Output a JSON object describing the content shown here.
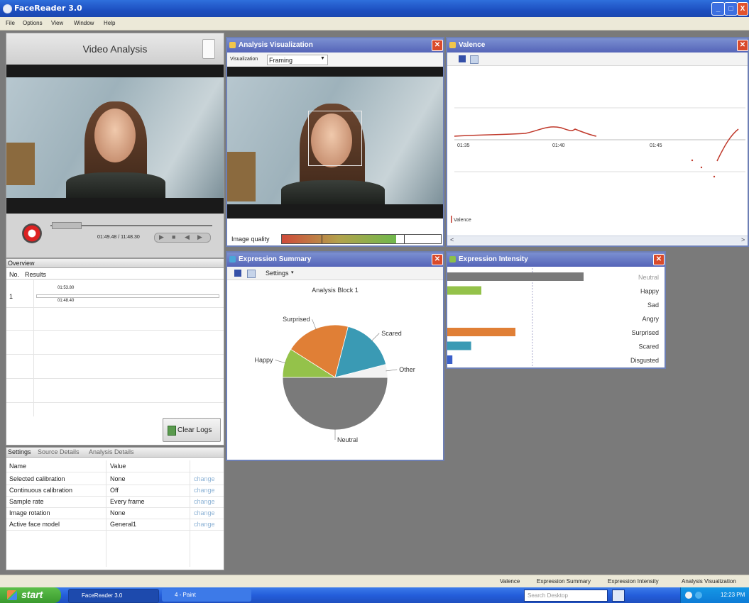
{
  "app": {
    "title": "FaceReader 3.0"
  },
  "window_buttons": {
    "minimize": "_",
    "maximize": "□",
    "close": "X"
  },
  "menu": [
    "File",
    "Options",
    "View",
    "Window",
    "Help"
  ],
  "video_panel": {
    "title": "Video Analysis",
    "time": "01:49.48 / 11:48.30"
  },
  "overview": {
    "title": "Overview",
    "columns": [
      "No.",
      "Results"
    ],
    "rows": [
      {
        "no": "1",
        "time_start": "01:53.80",
        "time_end": "01:48.40"
      }
    ],
    "clear_logs": "Clear Logs"
  },
  "settings": {
    "tabs": [
      "Settings",
      "Source Details",
      "Analysis Details"
    ],
    "columns": [
      "Name",
      "Value"
    ],
    "rows": [
      {
        "name": "Selected calibration",
        "value": "None",
        "action": "change"
      },
      {
        "name": "Continuous calibration",
        "value": "Off",
        "action": "change"
      },
      {
        "name": "Sample rate",
        "value": "Every frame",
        "action": "change"
      },
      {
        "name": "Image rotation",
        "value": "None",
        "action": "change"
      },
      {
        "name": "Active face model",
        "value": "General1",
        "action": "change"
      }
    ]
  },
  "analysis_vis": {
    "title": "Analysis Visualization",
    "vis_label": "Visualization",
    "vis_value": "Framing",
    "image_quality_label": "Image quality",
    "image_quality": 0.72
  },
  "valence": {
    "title": "Valence",
    "ticks": [
      "01:35",
      "01:40",
      "01:45"
    ],
    "legend": "Valence"
  },
  "expression_summary": {
    "title": "Expression Summary",
    "settings_label": "Settings",
    "chart_title": "Analysis Block 1"
  },
  "expression_intensity": {
    "title": "Expression Intensity"
  },
  "chart_data": [
    {
      "type": "pie",
      "title": "Analysis Block 1",
      "categories": [
        "Neutral",
        "Happy",
        "Surprised",
        "Scared",
        "Other"
      ],
      "values": [
        50,
        9,
        20,
        17,
        4
      ],
      "colors": [
        "#7a7a7a",
        "#94c24a",
        "#e07f36",
        "#3a9ab4",
        "#f2f2f2"
      ]
    },
    {
      "type": "bar",
      "title": "",
      "categories": [
        "Neutral",
        "Happy",
        "Sad",
        "Angry",
        "Surprised",
        "Scared",
        "Disgusted"
      ],
      "values": [
        0.8,
        0.2,
        0.0,
        0.0,
        0.4,
        0.14,
        0.03
      ],
      "colors": [
        "#7a7a7a",
        "#94c24a",
        "#4a74c9",
        "#c94a3a",
        "#e07f36",
        "#3a9ab4",
        "#3a5fc9"
      ],
      "ylim": [
        0,
        1
      ]
    }
  ],
  "statusbar": {
    "items": [
      "Valence",
      "Expression Summary",
      "Expression Intensity",
      "Analysis Visualization"
    ]
  },
  "taskbar": {
    "start": "start",
    "items": [
      "FaceReader 3.0",
      "4 - Paint"
    ],
    "search_placeholder": "Search Desktop",
    "clock": "12:23 PM"
  }
}
